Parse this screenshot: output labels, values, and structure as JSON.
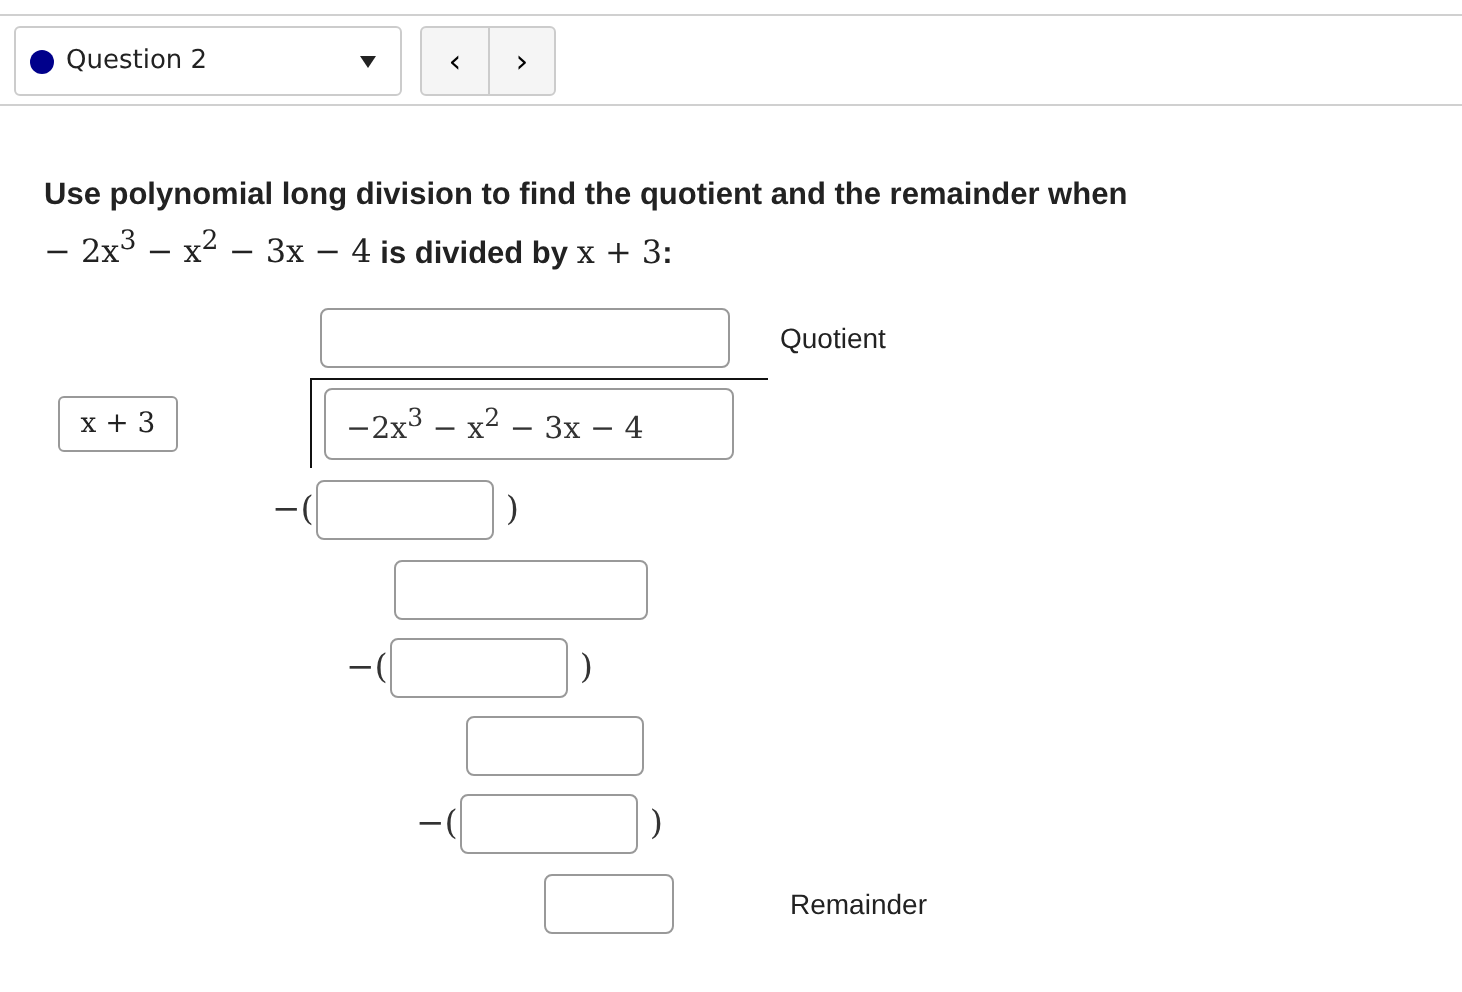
{
  "question_nav": {
    "label": "Question 2",
    "color": "#00008b",
    "prev": "‹",
    "next": "›"
  },
  "prompt": [
    {
      "kind": "text",
      "s": "Use polynomial long division to find the quotient and the remainder when"
    },
    {
      "kind": "math",
      "s": "− 2x$^{3}$ − x$^{2}$ − 3x − 4"
    },
    {
      "kind": "text",
      "s": " is divided by "
    },
    {
      "kind": "math",
      "s": "x + 3"
    },
    {
      "kind": "text",
      "s": ":"
    }
  ],
  "quotient_label": "Quotient",
  "divisor": "x + 3",
  "dividend": "−2x$^{3}$ − x$^{2}$ − 3x − 4",
  "work_rows": [
    {
      "kind": "subtract",
      "open": "−(",
      "close": ")"
    },
    {
      "kind": "difference"
    },
    {
      "kind": "subtract",
      "open": "−(",
      "close": ")"
    },
    {
      "kind": "difference"
    },
    {
      "kind": "subtract",
      "open": "−(",
      "close": ")"
    },
    {
      "kind": "remainder",
      "label": "Remainder"
    }
  ]
}
